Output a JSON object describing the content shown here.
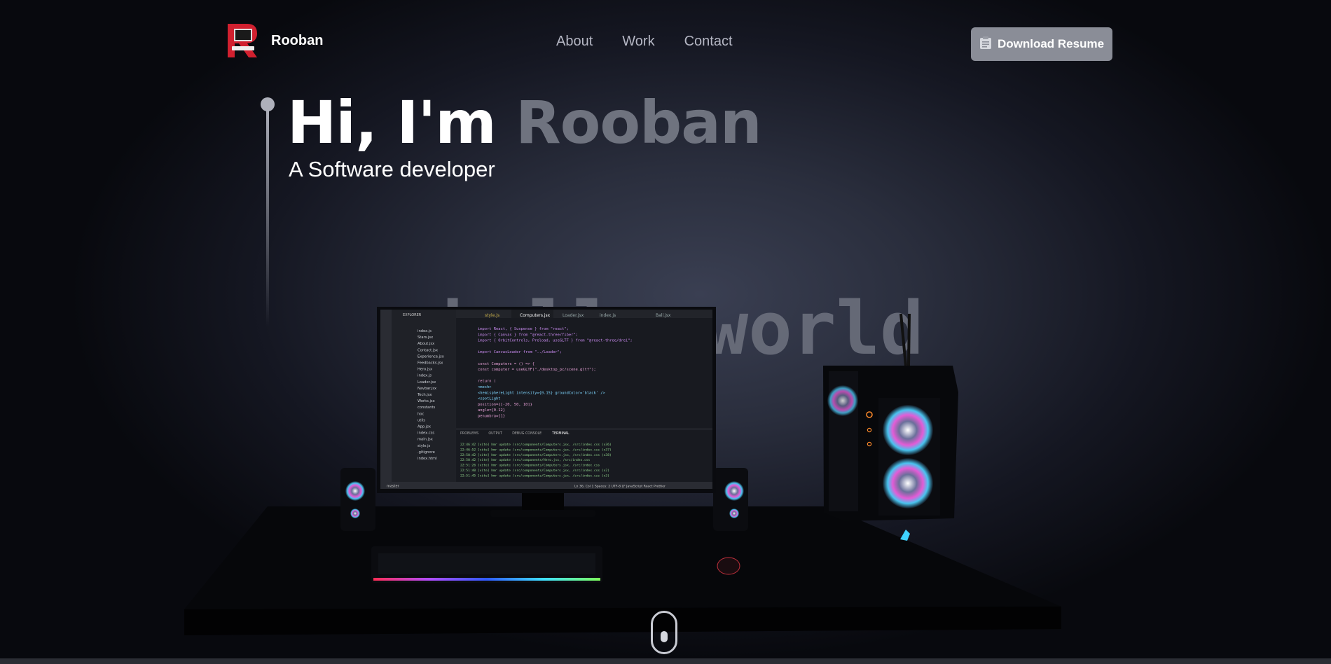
{
  "nav": {
    "brand": "Rooban",
    "links": [
      "About",
      "Work",
      "Contact"
    ],
    "download_label": "Download Resume"
  },
  "hero": {
    "greeting": "Hi, I'm ",
    "name": "Rooban",
    "subtitle": "A Software developer"
  },
  "scene": {
    "backdrop_text": "hello world",
    "editor": {
      "tabs": [
        "style.js",
        "Computers.jsx",
        "Loader.jsx",
        "index.js",
        "Ball.jsx"
      ],
      "explorer_title": "EXPLORER",
      "files": [
        "index.js",
        "Stars.jsx",
        "About.jsx",
        "Contact.jsx",
        "Experience.jsx",
        "Feedbacks.jsx",
        "Hero.jsx",
        "index.js",
        "Loader.jsx",
        "Navbar.jsx",
        "Tech.jsx",
        "Works.jsx",
        "constants",
        "hoc",
        "utils",
        "App.jsx",
        "index.css",
        "main.jsx",
        "style.js",
        ".gitignore",
        "index.html"
      ],
      "code_lines": [
        "import React, { Suspense } from \"react\";",
        "import { Canvas } from \"@react-three/fiber\";",
        "import { OrbitControls, Preload, useGLTF } from \"@react-three/drei\";",
        "",
        "import CanvasLoader from \"../Loader\";",
        "",
        "const Computers = () => {",
        "  const computer = useGLTF(\"./desktop_pc/scene.gltf\");",
        "",
        "  return (",
        "    <mesh>",
        "      <hemisphereLight intensity={0.15} groundColor='black' />",
        "      <spotLight",
        "        position={[-20, 50, 10]}",
        "        angle={0.12}",
        "        penumbra={1}"
      ],
      "panel_tabs": [
        "PROBLEMS",
        "OUTPUT",
        "DEBUG CONSOLE",
        "TERMINAL"
      ],
      "terminal_lines": [
        "22:46:42 [vite] hmr update /src/components/Computers.jsx, /src/index.css (x36)",
        "22:46:52 [vite] hmr update /src/components/Computers.jsx, /src/index.css (x37)",
        "22:50:42 [vite] hmr update /src/components/Computers.jsx, /src/index.css (x38)",
        "22:50:42 [vite] hmr update /src/components/Hero.jsx, /src/index.css",
        "22:51:26 [vite] hmr update /src/components/Computers.jsx, /src/index.css",
        "22:51:40 [vite] hmr update /src/components/Computers.jsx, /src/index.css (x2)",
        "22:51:45 [vite] hmr update /src/components/Computers.jsx, /src/index.css (x3)"
      ],
      "status_left": "master",
      "status_right": "Ln 36, Col 1   Spaces: 2   UTF-8   LF   JavaScript React   Prettier"
    }
  },
  "colors": {
    "accent": "#6f737f",
    "button": "#8a8d97",
    "logo_red": "#d1202f"
  }
}
